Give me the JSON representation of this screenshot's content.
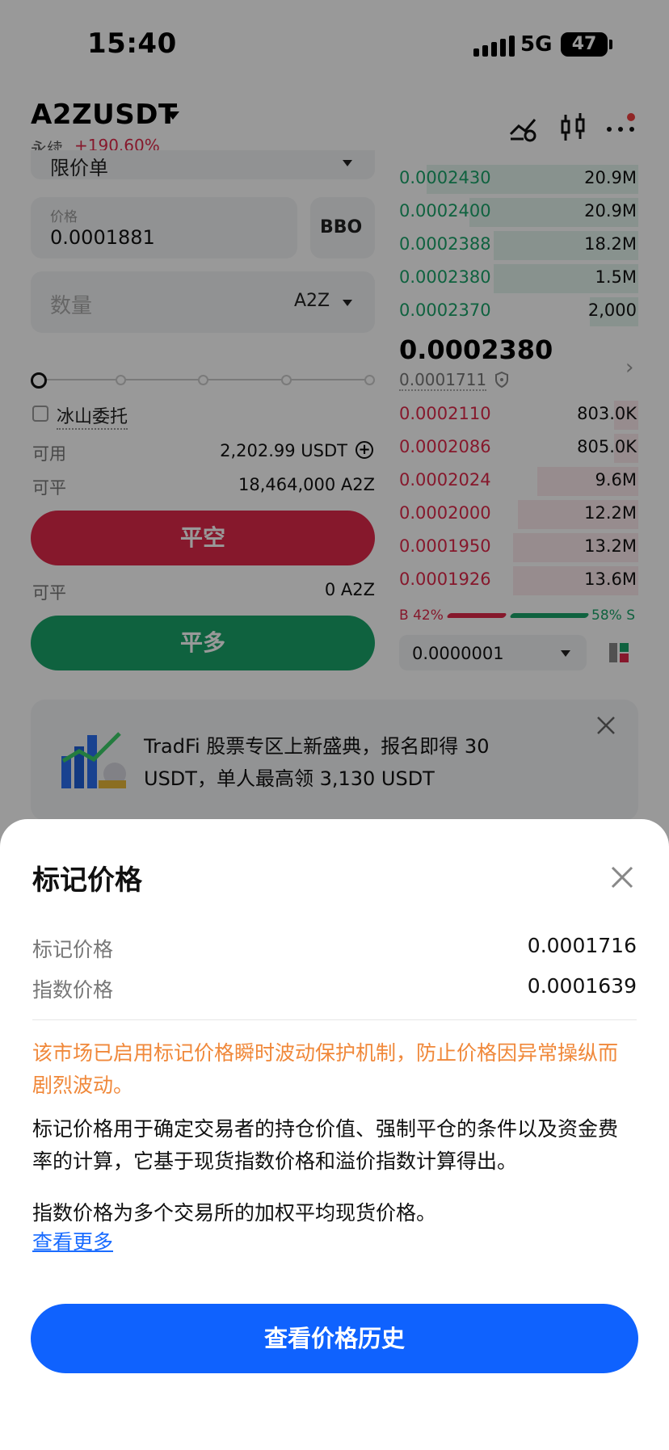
{
  "status_bar": {
    "time": "15:40",
    "network": "5G",
    "battery": "47"
  },
  "header": {
    "symbol": "A2ZUSDT",
    "contract_type": "永续",
    "change": "+190.60%"
  },
  "order_form": {
    "order_type": "限价单",
    "price_label": "价格",
    "price_value": "0.0001881",
    "bbo_label": "BBO",
    "quantity_placeholder": "数量",
    "quantity_unit": "A2Z",
    "iceberg_label": "冰山委托",
    "available_label": "可用",
    "available_value": "2,202.99 USDT",
    "closable_label": "可平",
    "closable_short_value": "18,464,000 A2Z",
    "close_short_button": "平空",
    "closable_label_2": "可平",
    "closable_long_value": "0 A2Z",
    "close_long_button": "平多"
  },
  "order_book": {
    "asks": [
      {
        "price": "0.0002430",
        "qty": "20.9M",
        "depth": 0.88
      },
      {
        "price": "0.0002400",
        "qty": "20.9M",
        "depth": 0.7
      },
      {
        "price": "0.0002388",
        "qty": "18.2M",
        "depth": 0.6
      },
      {
        "price": "0.0002380",
        "qty": "1.5M",
        "depth": 0.6
      },
      {
        "price": "0.0002370",
        "qty": "2,000",
        "depth": 0.2
      }
    ],
    "last_price": "0.0002380",
    "mark_price_small": "0.0001711",
    "bids": [
      {
        "price": "0.0002110",
        "qty": "803.0K",
        "depth": 0.1
      },
      {
        "price": "0.0002086",
        "qty": "805.0K",
        "depth": 0.1
      },
      {
        "price": "0.0002024",
        "qty": "9.6M",
        "depth": 0.42
      },
      {
        "price": "0.0002000",
        "qty": "12.2M",
        "depth": 0.5
      },
      {
        "price": "0.0001950",
        "qty": "13.2M",
        "depth": 0.52
      },
      {
        "price": "0.0001926",
        "qty": "13.6M",
        "depth": 0.52
      }
    ],
    "buy_ratio": "B 42%",
    "sell_ratio": "58% S",
    "tick_size": "0.0000001"
  },
  "banner": {
    "text": "TradFi 股票专区上新盛典，报名即得 30 USDT，单人最高领 3,130 USDT"
  },
  "sheet": {
    "title": "标记价格",
    "mark_price_label": "标记价格",
    "mark_price_value": "0.0001716",
    "index_price_label": "指数价格",
    "index_price_value": "0.0001639",
    "warning": "该市场已启用标记价格瞬时波动保护机制，防止价格因异常操纵而剧烈波动。",
    "description_1": "标记价格用于确定交易者的持仓价值、强制平仓的条件以及资金费率的计算，它基于现货指数价格和溢价指数计算得出。",
    "description_2": "指数价格为多个交易所的加权平均现货价格。",
    "learn_more": "查看更多",
    "cta_button": "查看价格历史"
  },
  "colors": {
    "ask_green": "#1aa36a",
    "bid_red": "#e0294a",
    "primary_blue": "#0f62fe",
    "warning_orange": "#f0883a"
  }
}
